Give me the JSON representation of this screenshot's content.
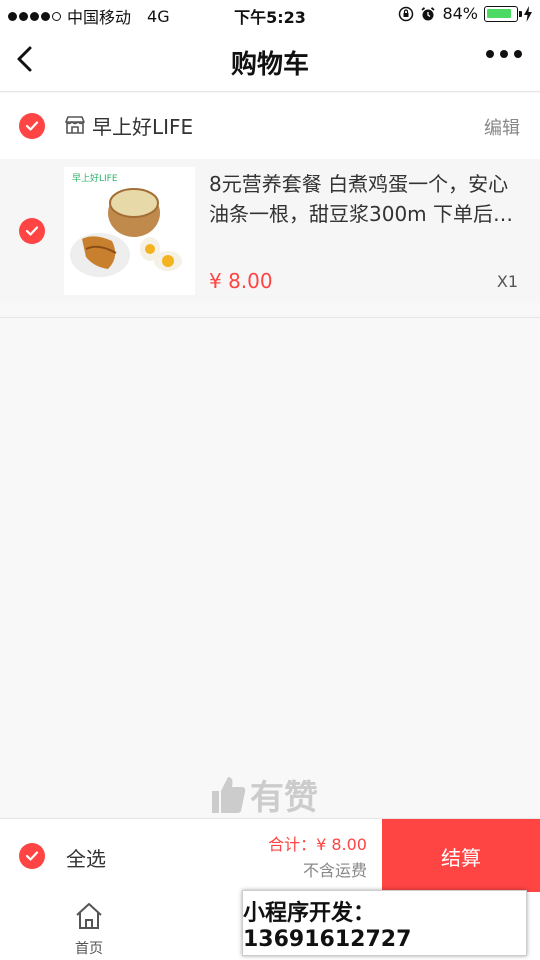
{
  "status_bar": {
    "carrier": "中国移动",
    "network": "4G",
    "time": "下午5:23",
    "battery": "84%",
    "battery_level": 0.84
  },
  "nav": {
    "title": "购物车",
    "back_icon": "back-arrow-icon",
    "more_icon": "more-dots-icon"
  },
  "shop": {
    "name": "早上好LIFE",
    "edit_label": "编辑",
    "checked": true
  },
  "item": {
    "thumb_label": "早上好LIFE",
    "description": "8元营养套餐 白煮鸡蛋一个，安心油条一根，甜豆浆300m 下单后…",
    "price": "¥ 8.00",
    "quantity": "X1",
    "checked": true
  },
  "watermark": "有赞",
  "checkout": {
    "select_all_label": "全选",
    "total": "合计：¥ 8.00",
    "shipping_note": "不含运费",
    "pay_label": "结算"
  },
  "tabbar": {
    "home_label": "首页"
  },
  "promo": "小程序开发：13691612727",
  "colors": {
    "accent": "#ff4444",
    "battery": "#4cd964"
  }
}
